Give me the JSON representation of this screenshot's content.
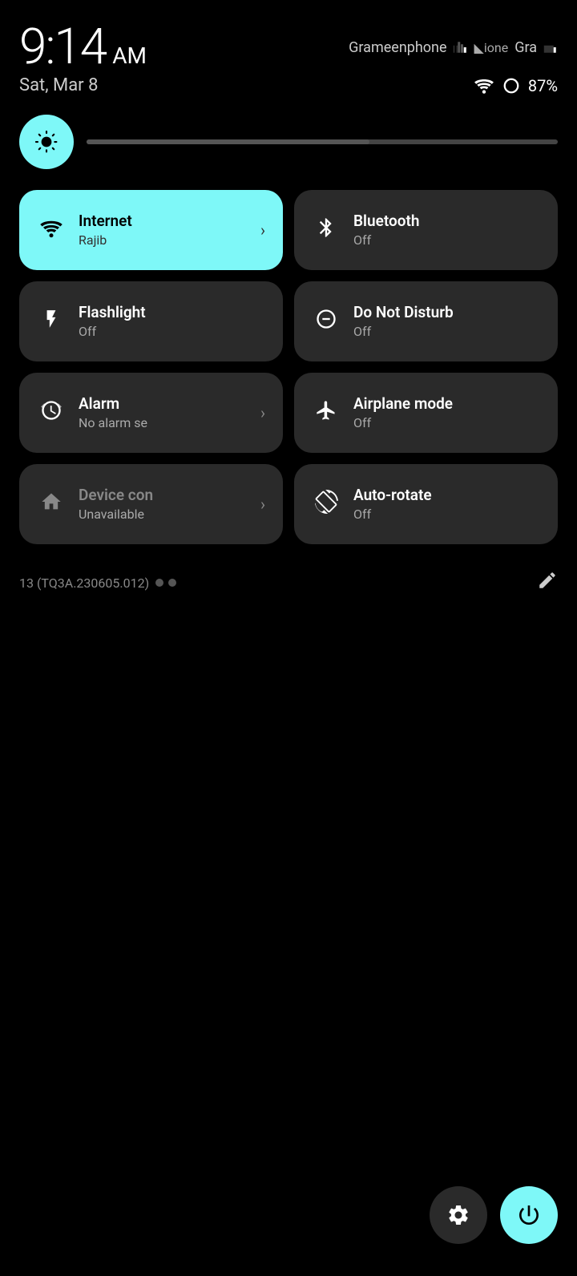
{
  "status": {
    "time": "9:14",
    "ampm": "AM",
    "carrier1": "Grameenphone",
    "carrier2": "Gra",
    "date": "Sat, Mar 8",
    "battery": "87%",
    "wifi": true,
    "signal1": true,
    "signal2": true
  },
  "brightness": {
    "icon": "⚙"
  },
  "tiles": [
    {
      "id": "internet",
      "title": "Internet",
      "subtitle": "Rajib",
      "icon": "wifi",
      "active": true,
      "hasArrow": true
    },
    {
      "id": "bluetooth",
      "title": "Bluetooth",
      "subtitle": "Off",
      "icon": "bluetooth",
      "active": false,
      "hasArrow": false
    },
    {
      "id": "flashlight",
      "title": "Flashlight",
      "subtitle": "Off",
      "icon": "flashlight",
      "active": false,
      "hasArrow": false
    },
    {
      "id": "donotdisturb",
      "title": "Do Not Disturb",
      "subtitle": "Off",
      "icon": "dnd",
      "active": false,
      "hasArrow": false
    },
    {
      "id": "alarm",
      "title": "Alarm",
      "subtitle": "No alarm se",
      "icon": "alarm",
      "active": false,
      "hasArrow": true
    },
    {
      "id": "airplanemode",
      "title": "Airplane mode",
      "subtitle": "Off",
      "icon": "airplane",
      "active": false,
      "hasArrow": false
    },
    {
      "id": "devicecontrols",
      "title": "Device con",
      "subtitle": "Unavailable",
      "icon": "home",
      "active": false,
      "hasArrow": true
    },
    {
      "id": "autorotate",
      "title": "Auto-rotate",
      "subtitle": "Off",
      "icon": "rotate",
      "active": false,
      "hasArrow": false
    }
  ],
  "footer": {
    "build": "13 (TQ3A.230605.012)",
    "editIcon": "✏"
  },
  "bottomButtons": {
    "settingsLabel": "Settings",
    "powerLabel": "Power"
  }
}
